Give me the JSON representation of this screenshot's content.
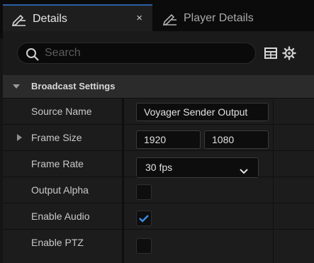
{
  "tabs": [
    {
      "label": "Details",
      "icon": "pencil-lines-icon",
      "active": true
    },
    {
      "label": "Player Details",
      "icon": "pencil-lines-icon",
      "active": false
    }
  ],
  "tab_close_glyph": "×",
  "search": {
    "placeholder": "Search"
  },
  "section": {
    "title": "Broadcast Settings"
  },
  "rows": [
    {
      "name": "Source Name",
      "value": "Voyager Sender Output"
    },
    {
      "name": "Frame Size",
      "width": "1920",
      "height": "1080"
    },
    {
      "name": "Frame Rate",
      "value": "30 fps"
    },
    {
      "name": "Output Alpha",
      "checked": false
    },
    {
      "name": "Enable Audio",
      "checked": true
    },
    {
      "name": "Enable PTZ",
      "checked": false
    }
  ],
  "colors": {
    "accent": "#2b5fa6",
    "check": "#3a8ee6"
  }
}
